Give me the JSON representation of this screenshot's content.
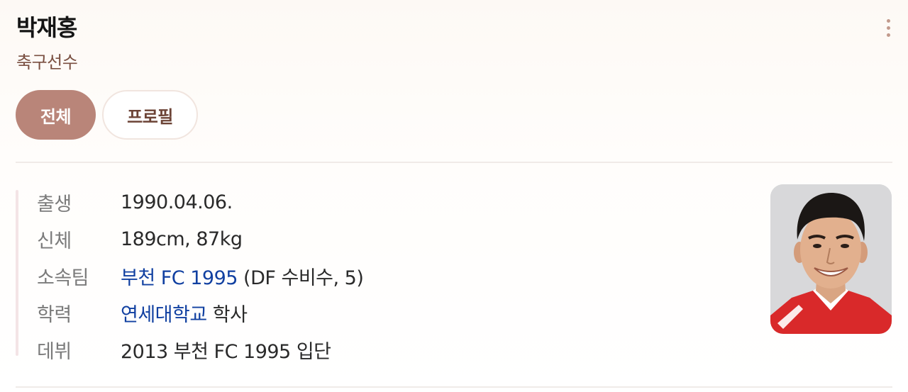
{
  "header": {
    "name": "박재홍",
    "occupation": "축구선수"
  },
  "tabs": [
    {
      "label": "전체",
      "active": true
    },
    {
      "label": "프로필",
      "active": false
    }
  ],
  "profile": {
    "birth": {
      "label": "출생",
      "value": "1990.04.06."
    },
    "body": {
      "label": "신체",
      "value": "189cm, 87kg"
    },
    "team": {
      "label": "소속팀",
      "link": "부천 FC 1995",
      "rest": " (DF 수비수, 5)"
    },
    "education": {
      "label": "학력",
      "link": "연세대학교",
      "rest": " 학사"
    },
    "debut": {
      "label": "데뷔",
      "value": "2013 부천 FC 1995 입단"
    }
  },
  "colors": {
    "accent": "#b98579",
    "link": "#1140a1",
    "subtitle": "#7a4f41"
  },
  "icons": {
    "more": "more-vertical-icon"
  }
}
